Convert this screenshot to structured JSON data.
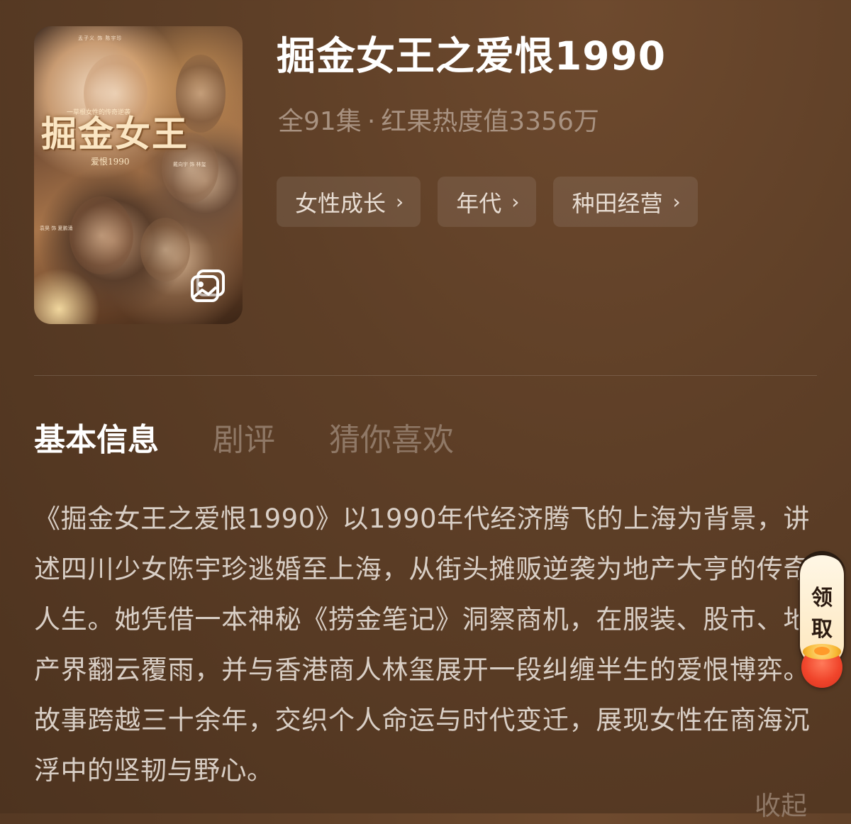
{
  "show": {
    "title": "掘金女王之爱恨1990",
    "episodes": "全91集",
    "separator": "·",
    "popularity": "红果热度值3356万",
    "tags": [
      {
        "label": "女性成长",
        "icon": "chevron-right-icon"
      },
      {
        "label": "年代",
        "icon": "chevron-right-icon"
      },
      {
        "label": "种田经营",
        "icon": "chevron-right-icon"
      }
    ]
  },
  "poster": {
    "title_text": "掘金女王",
    "subtitle_text": "爱恨1990",
    "tagline": "一草根女性的传奇逆袭",
    "credits_top": "孟子义 饰 陈宇珍",
    "credits_mid": "戴向宇 饰 林玺",
    "credits_low": "袁昊 饰 夏鹏涌",
    "gallery_icon": "image-gallery-icon"
  },
  "tabs": [
    {
      "label": "基本信息",
      "active": true
    },
    {
      "label": "剧评",
      "active": false
    },
    {
      "label": "猜你喜欢",
      "active": false
    }
  ],
  "description": "《掘金女王之爱恨1990》以1990年代经济腾飞的上海为背景，讲述四川少女陈宇珍逃婚至上海，从街头摊贩逆袭为地产大亨的传奇人生。她凭借一本神秘《捞金笔记》洞察商机，在服装、股市、地产界翻云覆雨，并与香港商人林玺展开一段纠缠半生的爱恨博弈。故事跨越三十余年，交织个人命运与时代变迁，展现女性在商海沉浮中的坚韧与野心。",
  "collapse_label": "收起",
  "reward_widget": {
    "line1": "领",
    "line2": "取",
    "icon": "gold-ingot-icon"
  },
  "colors": {
    "background": "#5e3f27",
    "muted_text": "#a89281",
    "tab_inactive": "#8f7866",
    "body_text": "#d9cfc6"
  }
}
